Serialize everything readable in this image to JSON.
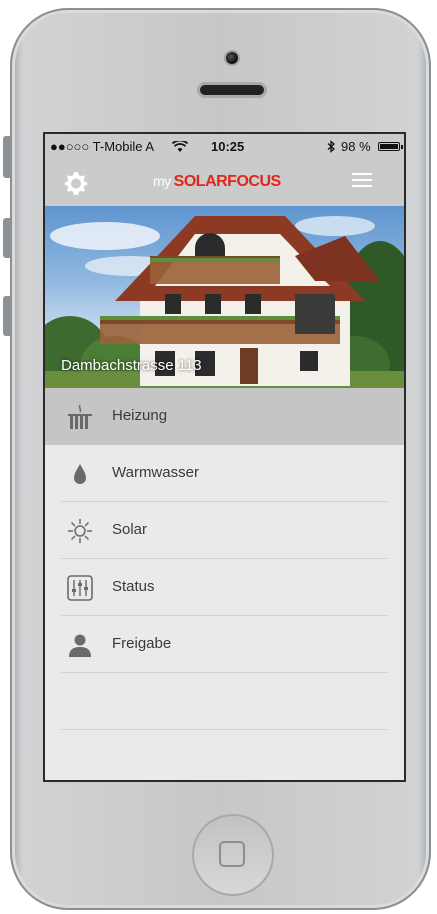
{
  "status": {
    "carrier": "●●○○○ T-Mobile A",
    "time": "10:25",
    "battery": "98 %"
  },
  "header": {
    "logo_prefix": "my",
    "logo_brand": "SOLARFOCUS",
    "settings_icon": "gear-icon",
    "menu_icon": "hamburger-icon"
  },
  "hero": {
    "address": "Dambachstrasse 113"
  },
  "menu": {
    "items": [
      {
        "label": "Heizung",
        "icon": "radiator-icon"
      },
      {
        "label": "Warmwasser",
        "icon": "water-drop-icon"
      },
      {
        "label": "Solar",
        "icon": "sun-icon"
      },
      {
        "label": "Status",
        "icon": "sliders-icon"
      },
      {
        "label": "Freigabe",
        "icon": "person-icon"
      }
    ]
  },
  "colors": {
    "brand": "#e2261a",
    "bar": "#cbcbcb",
    "active_row": "#c5c5c5"
  }
}
